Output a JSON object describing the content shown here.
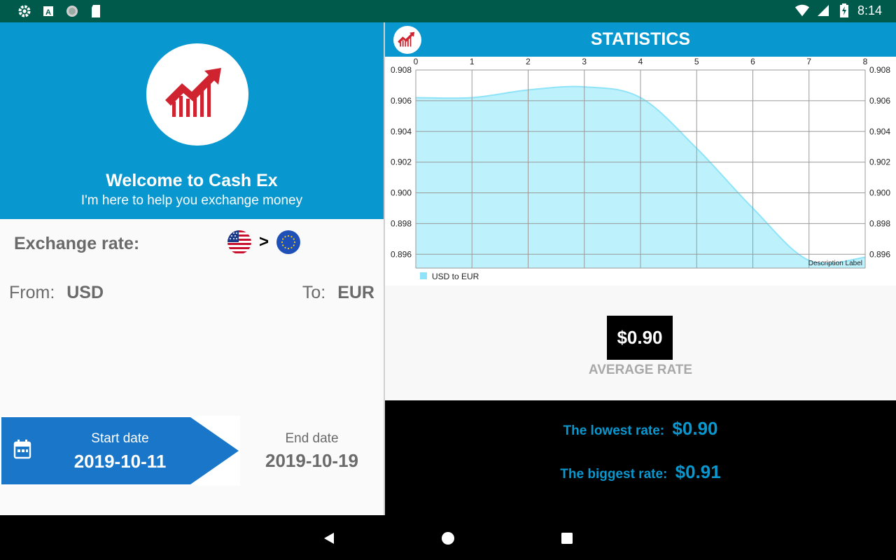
{
  "status_bar": {
    "time": "8:14",
    "icons_left": [
      "settings-icon",
      "font-a-icon",
      "sync-circle-icon",
      "sd-card-icon"
    ],
    "icons_right": [
      "wifi-icon",
      "signal-icon",
      "battery-charging-icon"
    ]
  },
  "left_panel": {
    "welcome_title": "Welcome to Cash Ex",
    "welcome_subtitle": "I'm here to help you exchange money",
    "exchange_rate_label": "Exchange rate:",
    "flag_arrow": ">",
    "from_label": "From:",
    "from_currency": "USD",
    "to_label": "To:",
    "to_currency": "EUR",
    "start_date_label": "Start date",
    "start_date_value": "2019-10-11",
    "end_date_label": "End date",
    "end_date_value": "2019-10-19"
  },
  "right_panel": {
    "title": "STATISTICS",
    "average_value": "$0.90",
    "average_label": "AVERAGE RATE",
    "lowest_label": "The lowest rate:",
    "lowest_value": "$0.90",
    "biggest_label": "The biggest rate:",
    "biggest_value": "$0.91"
  },
  "colors": {
    "primary": "#0897cf",
    "status_bar": "#005a4b",
    "date_active": "#1976c8",
    "chart_fill": "#b9f0fc",
    "chart_line": "#8fe3f8",
    "logo_red": "#d02330"
  },
  "chart_data": {
    "type": "area",
    "x": [
      0,
      1,
      2,
      3,
      4,
      5,
      6,
      7,
      8
    ],
    "x_ticks": [
      "0",
      "1",
      "2",
      "3",
      "4",
      "5",
      "6",
      "7",
      "8"
    ],
    "y_ticks": [
      "0.908",
      "0.906",
      "0.904",
      "0.902",
      "0.900",
      "0.898",
      "0.896"
    ],
    "series": [
      {
        "name": "USD to EUR",
        "values": [
          0.9062,
          0.9062,
          0.9067,
          0.9069,
          0.9062,
          0.9029,
          0.899,
          0.8956,
          0.8958
        ]
      }
    ],
    "xlim": [
      0,
      8
    ],
    "ylim": [
      0.8951,
      0.908
    ],
    "grid": true,
    "legend": "bottom-left",
    "description_label": "Description Label"
  }
}
